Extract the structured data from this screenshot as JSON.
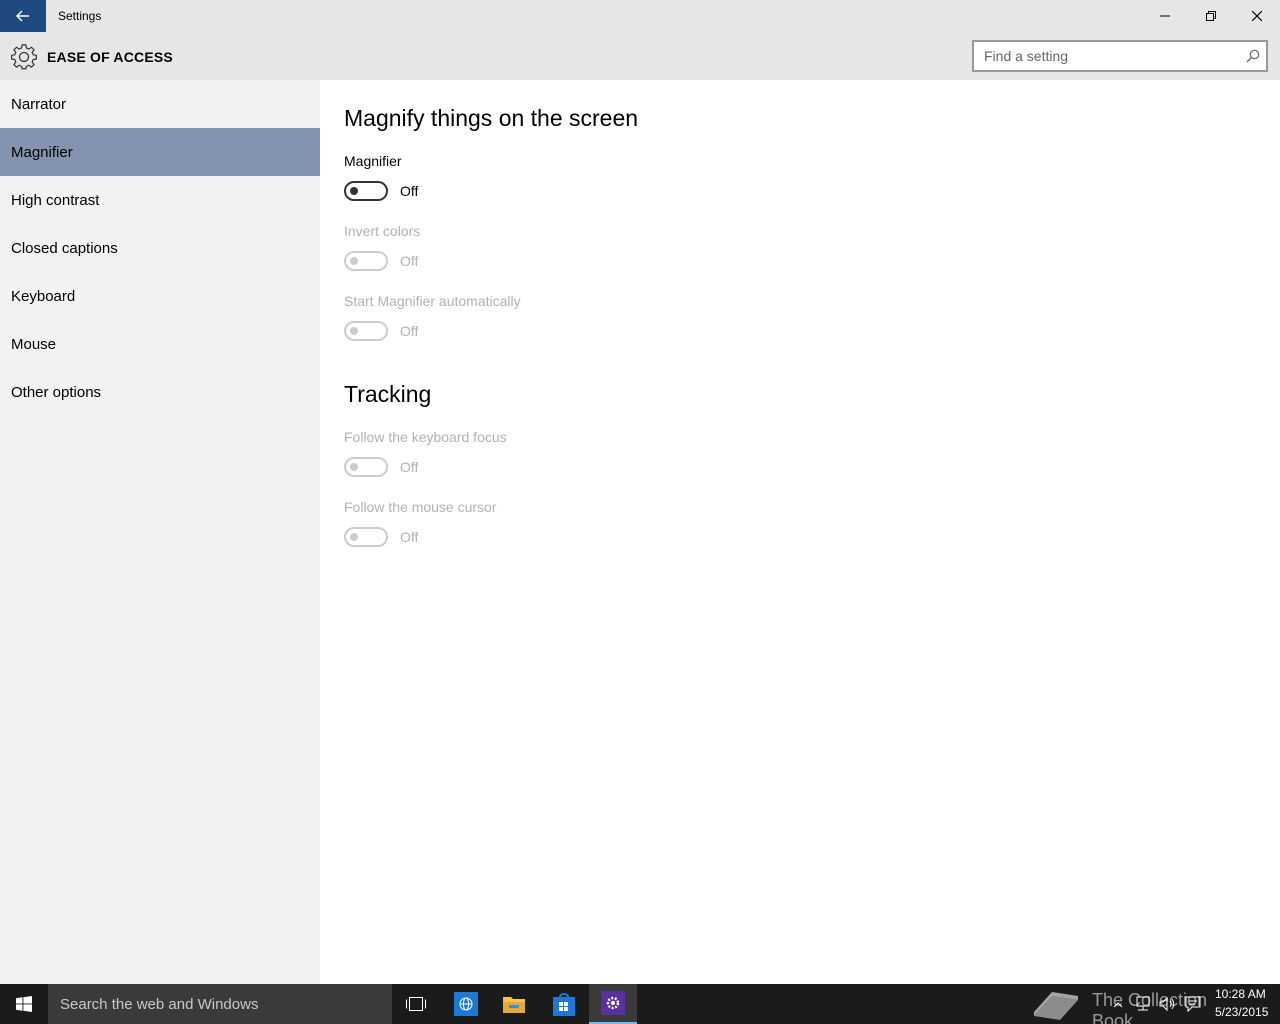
{
  "window": {
    "title": "Settings"
  },
  "header": {
    "section_title": "EASE OF ACCESS",
    "search_placeholder": "Find a setting"
  },
  "sidebar": {
    "items": [
      {
        "label": "Narrator",
        "selected": false
      },
      {
        "label": "Magnifier",
        "selected": true
      },
      {
        "label": "High contrast",
        "selected": false
      },
      {
        "label": "Closed captions",
        "selected": false
      },
      {
        "label": "Keyboard",
        "selected": false
      },
      {
        "label": "Mouse",
        "selected": false
      },
      {
        "label": "Other options",
        "selected": false
      }
    ],
    "selected_color": "#8494b0"
  },
  "main": {
    "heading": "Magnify things on the screen",
    "settings": [
      {
        "label": "Magnifier",
        "state": "Off",
        "enabled": true
      },
      {
        "label": "Invert colors",
        "state": "Off",
        "enabled": false
      },
      {
        "label": "Start Magnifier automatically",
        "state": "Off",
        "enabled": false
      }
    ],
    "tracking_heading": "Tracking",
    "tracking": [
      {
        "label": "Follow the keyboard focus",
        "state": "Off",
        "enabled": false
      },
      {
        "label": "Follow the mouse cursor",
        "state": "Off",
        "enabled": false
      }
    ]
  },
  "taskbar": {
    "search_text": "Search the web and Windows",
    "watermark": "The Collection Book",
    "time": "10:28 AM",
    "date": "5/23/2015"
  },
  "colors": {
    "accent": "#1e4a7f",
    "disabled_text": "#b2b2b2"
  }
}
